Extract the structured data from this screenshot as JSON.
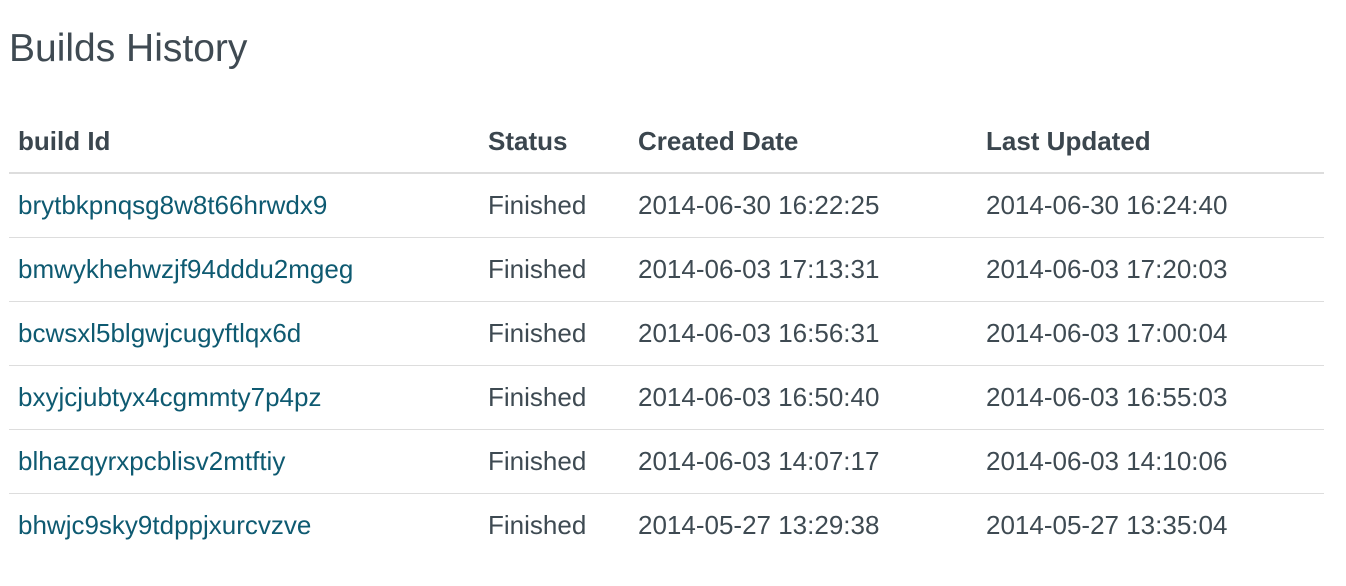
{
  "page": {
    "title": "Builds History"
  },
  "table": {
    "headers": {
      "build_id": "build Id",
      "status": "Status",
      "created": "Created Date",
      "updated": "Last Updated"
    },
    "rows": [
      {
        "build_id": "brytbkpnqsg8w8t66hrwdx9",
        "status": "Finished",
        "created": "2014-06-30 16:22:25",
        "updated": "2014-06-30 16:24:40"
      },
      {
        "build_id": "bmwykhehwzjf94dddu2mgeg",
        "status": "Finished",
        "created": "2014-06-03 17:13:31",
        "updated": "2014-06-03 17:20:03"
      },
      {
        "build_id": "bcwsxl5blgwjcugyftlqx6d",
        "status": "Finished",
        "created": "2014-06-03 16:56:31",
        "updated": "2014-06-03 17:00:04"
      },
      {
        "build_id": "bxyjcjubtyx4cgmmty7p4pz",
        "status": "Finished",
        "created": "2014-06-03 16:50:40",
        "updated": "2014-06-03 16:55:03"
      },
      {
        "build_id": "blhazqyrxpcblisv2mtftiy",
        "status": "Finished",
        "created": "2014-06-03 14:07:17",
        "updated": "2014-06-03 14:10:06"
      },
      {
        "build_id": "bhwjc9sky9tdppjxurcvzve",
        "status": "Finished",
        "created": "2014-05-27 13:29:38",
        "updated": "2014-05-27 13:35:04"
      }
    ]
  },
  "colors": {
    "link": "#0e5a71",
    "text": "#3e4a52",
    "divider": "#dddddd"
  }
}
